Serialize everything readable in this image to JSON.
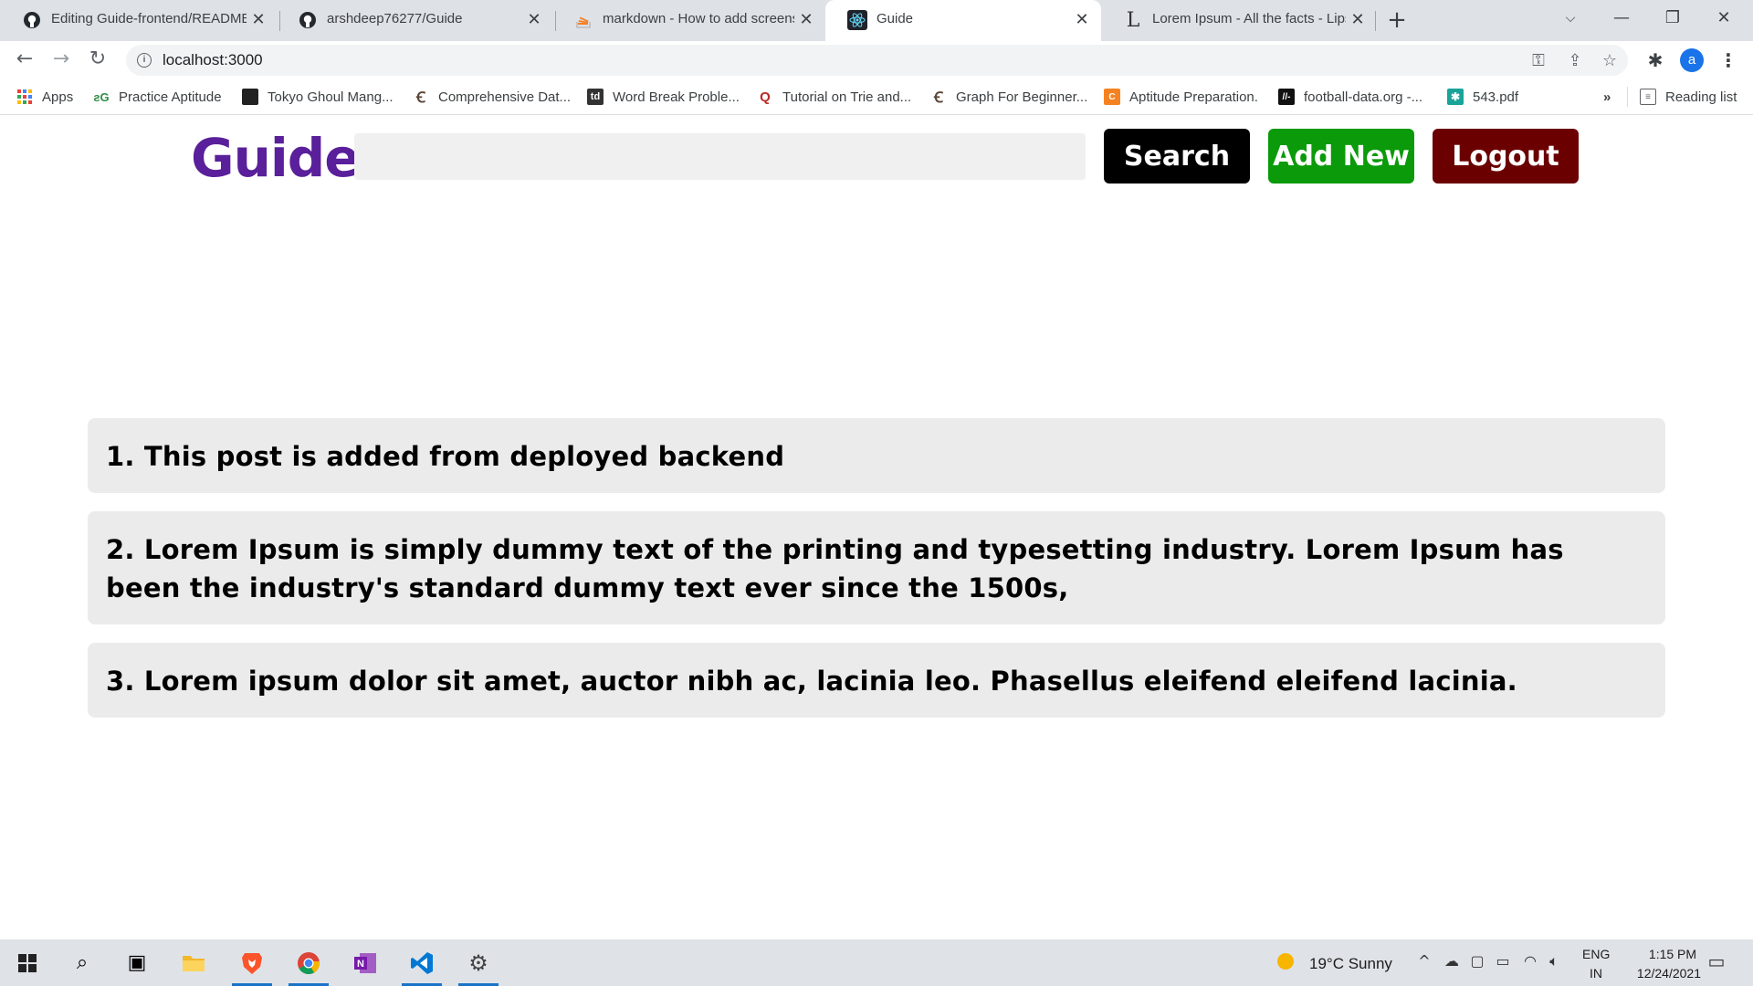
{
  "browser": {
    "tabs": [
      {
        "title": "Editing Guide-frontend/README",
        "icon": "github-icon"
      },
      {
        "title": "arshdeep76277/Guide",
        "icon": "github-icon"
      },
      {
        "title": "markdown - How to add screensh",
        "icon": "stackoverflow-icon"
      },
      {
        "title": "Guide",
        "icon": "react-icon",
        "active": true
      },
      {
        "title": "Lorem Ipsum - All the facts - Lips",
        "icon": "lipsum-icon"
      }
    ],
    "url": "localhost:3000",
    "profile_initial": "a",
    "bookmarks": [
      {
        "label": "Apps",
        "icon": "apps-grid-icon"
      },
      {
        "label": "Practice Aptitude",
        "icon": "gfg-icon"
      },
      {
        "label": "Tokyo Ghoul Mang...",
        "icon": "manga-icon"
      },
      {
        "label": "Comprehensive Dat...",
        "icon": "codechef-icon"
      },
      {
        "label": "Word Break Proble...",
        "icon": "td-icon"
      },
      {
        "label": "Tutorial on Trie and...",
        "icon": "quora-icon"
      },
      {
        "label": "Graph For Beginner...",
        "icon": "codechef-icon"
      },
      {
        "label": "Aptitude Preparation.",
        "icon": "ia-icon"
      },
      {
        "label": "football-data.org -...",
        "icon": "football-data-icon"
      },
      {
        "label": "543.pdf",
        "icon": "pdf-icon"
      }
    ],
    "overflow": "»",
    "reading_list": "Reading list"
  },
  "app": {
    "brand": "Guide",
    "search_placeholder": "",
    "buttons": {
      "search": "Search",
      "add_new": "Add New",
      "logout": "Logout"
    },
    "posts": [
      "1. This post is added from deployed backend",
      "2. Lorem Ipsum is simply dummy text of the printing and typesetting industry. Lorem Ipsum has been the industry's standard dummy text ever since the 1500s,",
      "3. Lorem ipsum dolor sit amet, auctor nibh ac, lacinia leo. Phasellus eleifend eleifend lacinia."
    ],
    "colors": {
      "brand": "#5a1f9a",
      "search_button": "#000000",
      "add_button": "#0a9a0a",
      "logout_button": "#6b0000",
      "post_background": "#ebebeb"
    }
  },
  "taskbar": {
    "weather": "19°C  Sunny",
    "language": "ENG",
    "region": "IN",
    "time": "1:15 PM",
    "date": "12/24/2021"
  }
}
